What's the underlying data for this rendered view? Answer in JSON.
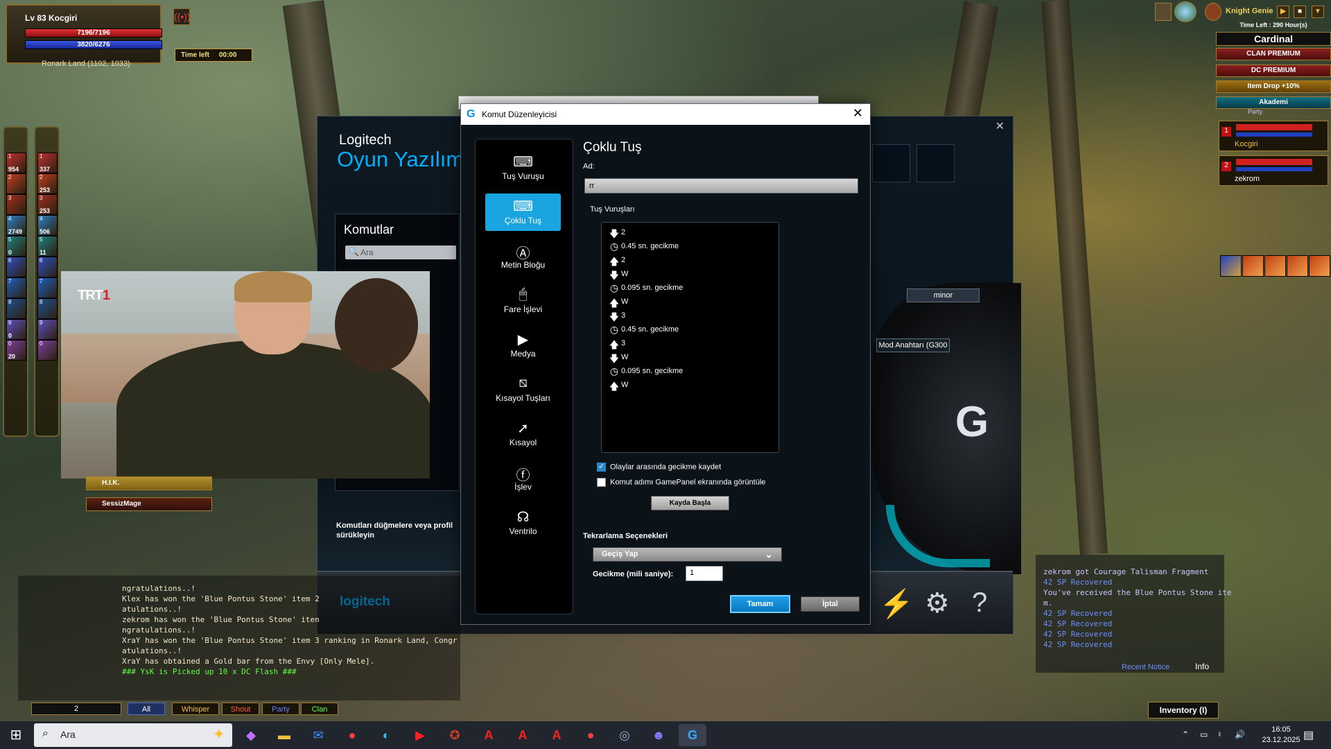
{
  "player": {
    "name": "Lv 83 Kocgiri",
    "hp": "7196/7196",
    "mp": "3820/6276",
    "location": "Ronark Land (1102, 1033)",
    "time_left_label": "Time left",
    "time_left_value": "00:00"
  },
  "skills_left": [
    {
      "num": "1",
      "count": "954"
    },
    {
      "num": "2",
      "count": ""
    },
    {
      "num": "3",
      "count": ""
    },
    {
      "num": "4",
      "count": "2749"
    },
    {
      "num": "5",
      "count": "0"
    },
    {
      "num": "6",
      "count": ""
    },
    {
      "num": "7",
      "count": ""
    },
    {
      "num": "8",
      "count": ""
    },
    {
      "num": "9",
      "count": "0"
    },
    {
      "num": "0",
      "count": "20"
    }
  ],
  "skills_right": [
    {
      "num": "1",
      "count": "337"
    },
    {
      "num": "2",
      "count": "253"
    },
    {
      "num": "3",
      "count": "253"
    },
    {
      "num": "4",
      "count": "506"
    },
    {
      "num": "5",
      "count": "11"
    },
    {
      "num": "6",
      "count": ""
    },
    {
      "num": "7",
      "count": ""
    },
    {
      "num": "8",
      "count": ""
    },
    {
      "num": "9",
      "count": ""
    },
    {
      "num": "0",
      "count": ""
    }
  ],
  "top_right": {
    "genie": "Knight Genie",
    "genie_time": "Time Left : 290 Hour(s)",
    "clan": "Cardinal",
    "badges": [
      "CLAN PREMIUM",
      "DC PREMIUM",
      "Item Drop +10%",
      "Akademi"
    ],
    "party_label": "Party",
    "party": [
      {
        "index": "1",
        "name": "Kocgiri"
      },
      {
        "index": "2",
        "name": "zekrom"
      }
    ]
  },
  "logitech": {
    "brand": "Logitech",
    "title": "Oyun Yazılım",
    "commands_title": "Komutlar",
    "search_placeholder": "Ara",
    "drag_hint": "Komutları düğmelere veya profil sürükleyin",
    "minor_label": "minor",
    "mod_label": "Mod Anahtarı (G300",
    "footer_logo": "logitech"
  },
  "video": {
    "channel_logo": "TRT",
    "channel_number": "1"
  },
  "clan_list": [
    "H.I.K.",
    "SessizMage"
  ],
  "dialog": {
    "title": "Komut Düzenleyicisi",
    "sidebar": [
      {
        "label": "Tuş Vuruşu",
        "icon": "key-icon"
      },
      {
        "label": "Çoklu Tuş",
        "icon": "multi-key-icon"
      },
      {
        "label": "Metin Bloğu",
        "icon": "text-block-icon"
      },
      {
        "label": "Fare İşlevi",
        "icon": "mouse-icon"
      },
      {
        "label": "Medya",
        "icon": "play-icon"
      },
      {
        "label": "Kısayol Tuşları",
        "icon": "hotkey-icon"
      },
      {
        "label": "Kısayol",
        "icon": "shortcut-arrow-icon"
      },
      {
        "label": "İşlev",
        "icon": "function-icon"
      },
      {
        "label": "Ventrilo",
        "icon": "headset-icon"
      }
    ],
    "heading": "Çoklu Tuş",
    "name_label": "Ad:",
    "name_value": "rr",
    "keystrokes_label": "Tuş Vuruşları",
    "keystrokes": [
      {
        "type": "down",
        "text": "2"
      },
      {
        "type": "delay",
        "text": "0.45 sn. gecikme"
      },
      {
        "type": "up",
        "text": "2"
      },
      {
        "type": "down",
        "text": "W"
      },
      {
        "type": "delay",
        "text": "0.095 sn. gecikme"
      },
      {
        "type": "up",
        "text": "W"
      },
      {
        "type": "down",
        "text": "3"
      },
      {
        "type": "delay",
        "text": "0.45 sn. gecikme"
      },
      {
        "type": "up",
        "text": "3"
      },
      {
        "type": "down",
        "text": "W"
      },
      {
        "type": "delay",
        "text": "0.095 sn. gecikme"
      },
      {
        "type": "up",
        "text": "W"
      }
    ],
    "check_record_delays": "Olaylar arasında gecikme kaydet",
    "check_record_delays_on": true,
    "check_show_gamepanel": "Komut adımı GamePanel ekranında görüntüle",
    "check_show_gamepanel_on": false,
    "record_button": "Kayda Başla",
    "repeat_label": "Tekrarlama Seçenekleri",
    "repeat_value": "Geçiş Yap",
    "delay_label": "Gecikme (mili saniye):",
    "delay_value": "1",
    "ok_button": "Tamam",
    "cancel_button": "İptal"
  },
  "chat": {
    "lines": [
      {
        "text": "ngratulations..!",
        "color": "normal"
      },
      {
        "text": "Klex has won the 'Blue Pontus Stone' item 2",
        "color": "normal"
      },
      {
        "text": "atulations..!",
        "color": "normal"
      },
      {
        "text": "zekrom has won the 'Blue Pontus Stone' iten",
        "color": "normal"
      },
      {
        "text": "ngratulations..!",
        "color": "normal"
      },
      {
        "text": "XraY has won the 'Blue Pontus Stone' item 3 ranking in Ronark Land, Congr",
        "color": "normal"
      },
      {
        "text": "atulations..!",
        "color": "normal"
      },
      {
        "text": "XraY has obtained a Gold bar from the Envy [Only Mele].",
        "color": "normal"
      },
      {
        "text": "### YsK is Picked up 10 x DC Flash ###",
        "color": "green"
      }
    ],
    "channel": "2",
    "tabs": [
      "All",
      "Whisper",
      "Shout",
      "Party",
      "Clan"
    ]
  },
  "notices": {
    "lines": [
      {
        "text": "zekrom got Courage Talisman Fragment",
        "color": "white"
      },
      {
        "text": "42 SP Recovered",
        "color": "blue"
      },
      {
        "text": "You've received the Blue Pontus Stone ite",
        "color": "white"
      },
      {
        "text": "m.",
        "color": "white"
      },
      {
        "text": "42 SP Recovered",
        "color": "blue"
      },
      {
        "text": "42 SP Recovered",
        "color": "blue"
      },
      {
        "text": "42 SP Recovered",
        "color": "blue"
      },
      {
        "text": "42 SP Recovered",
        "color": "blue"
      }
    ],
    "recent_tab": "Recent Notice",
    "info_tab": "Info",
    "inventory": "Inventory (I)"
  },
  "taskbar": {
    "search_placeholder": "Ara",
    "time": "16:05",
    "date": "23.12.2025"
  }
}
